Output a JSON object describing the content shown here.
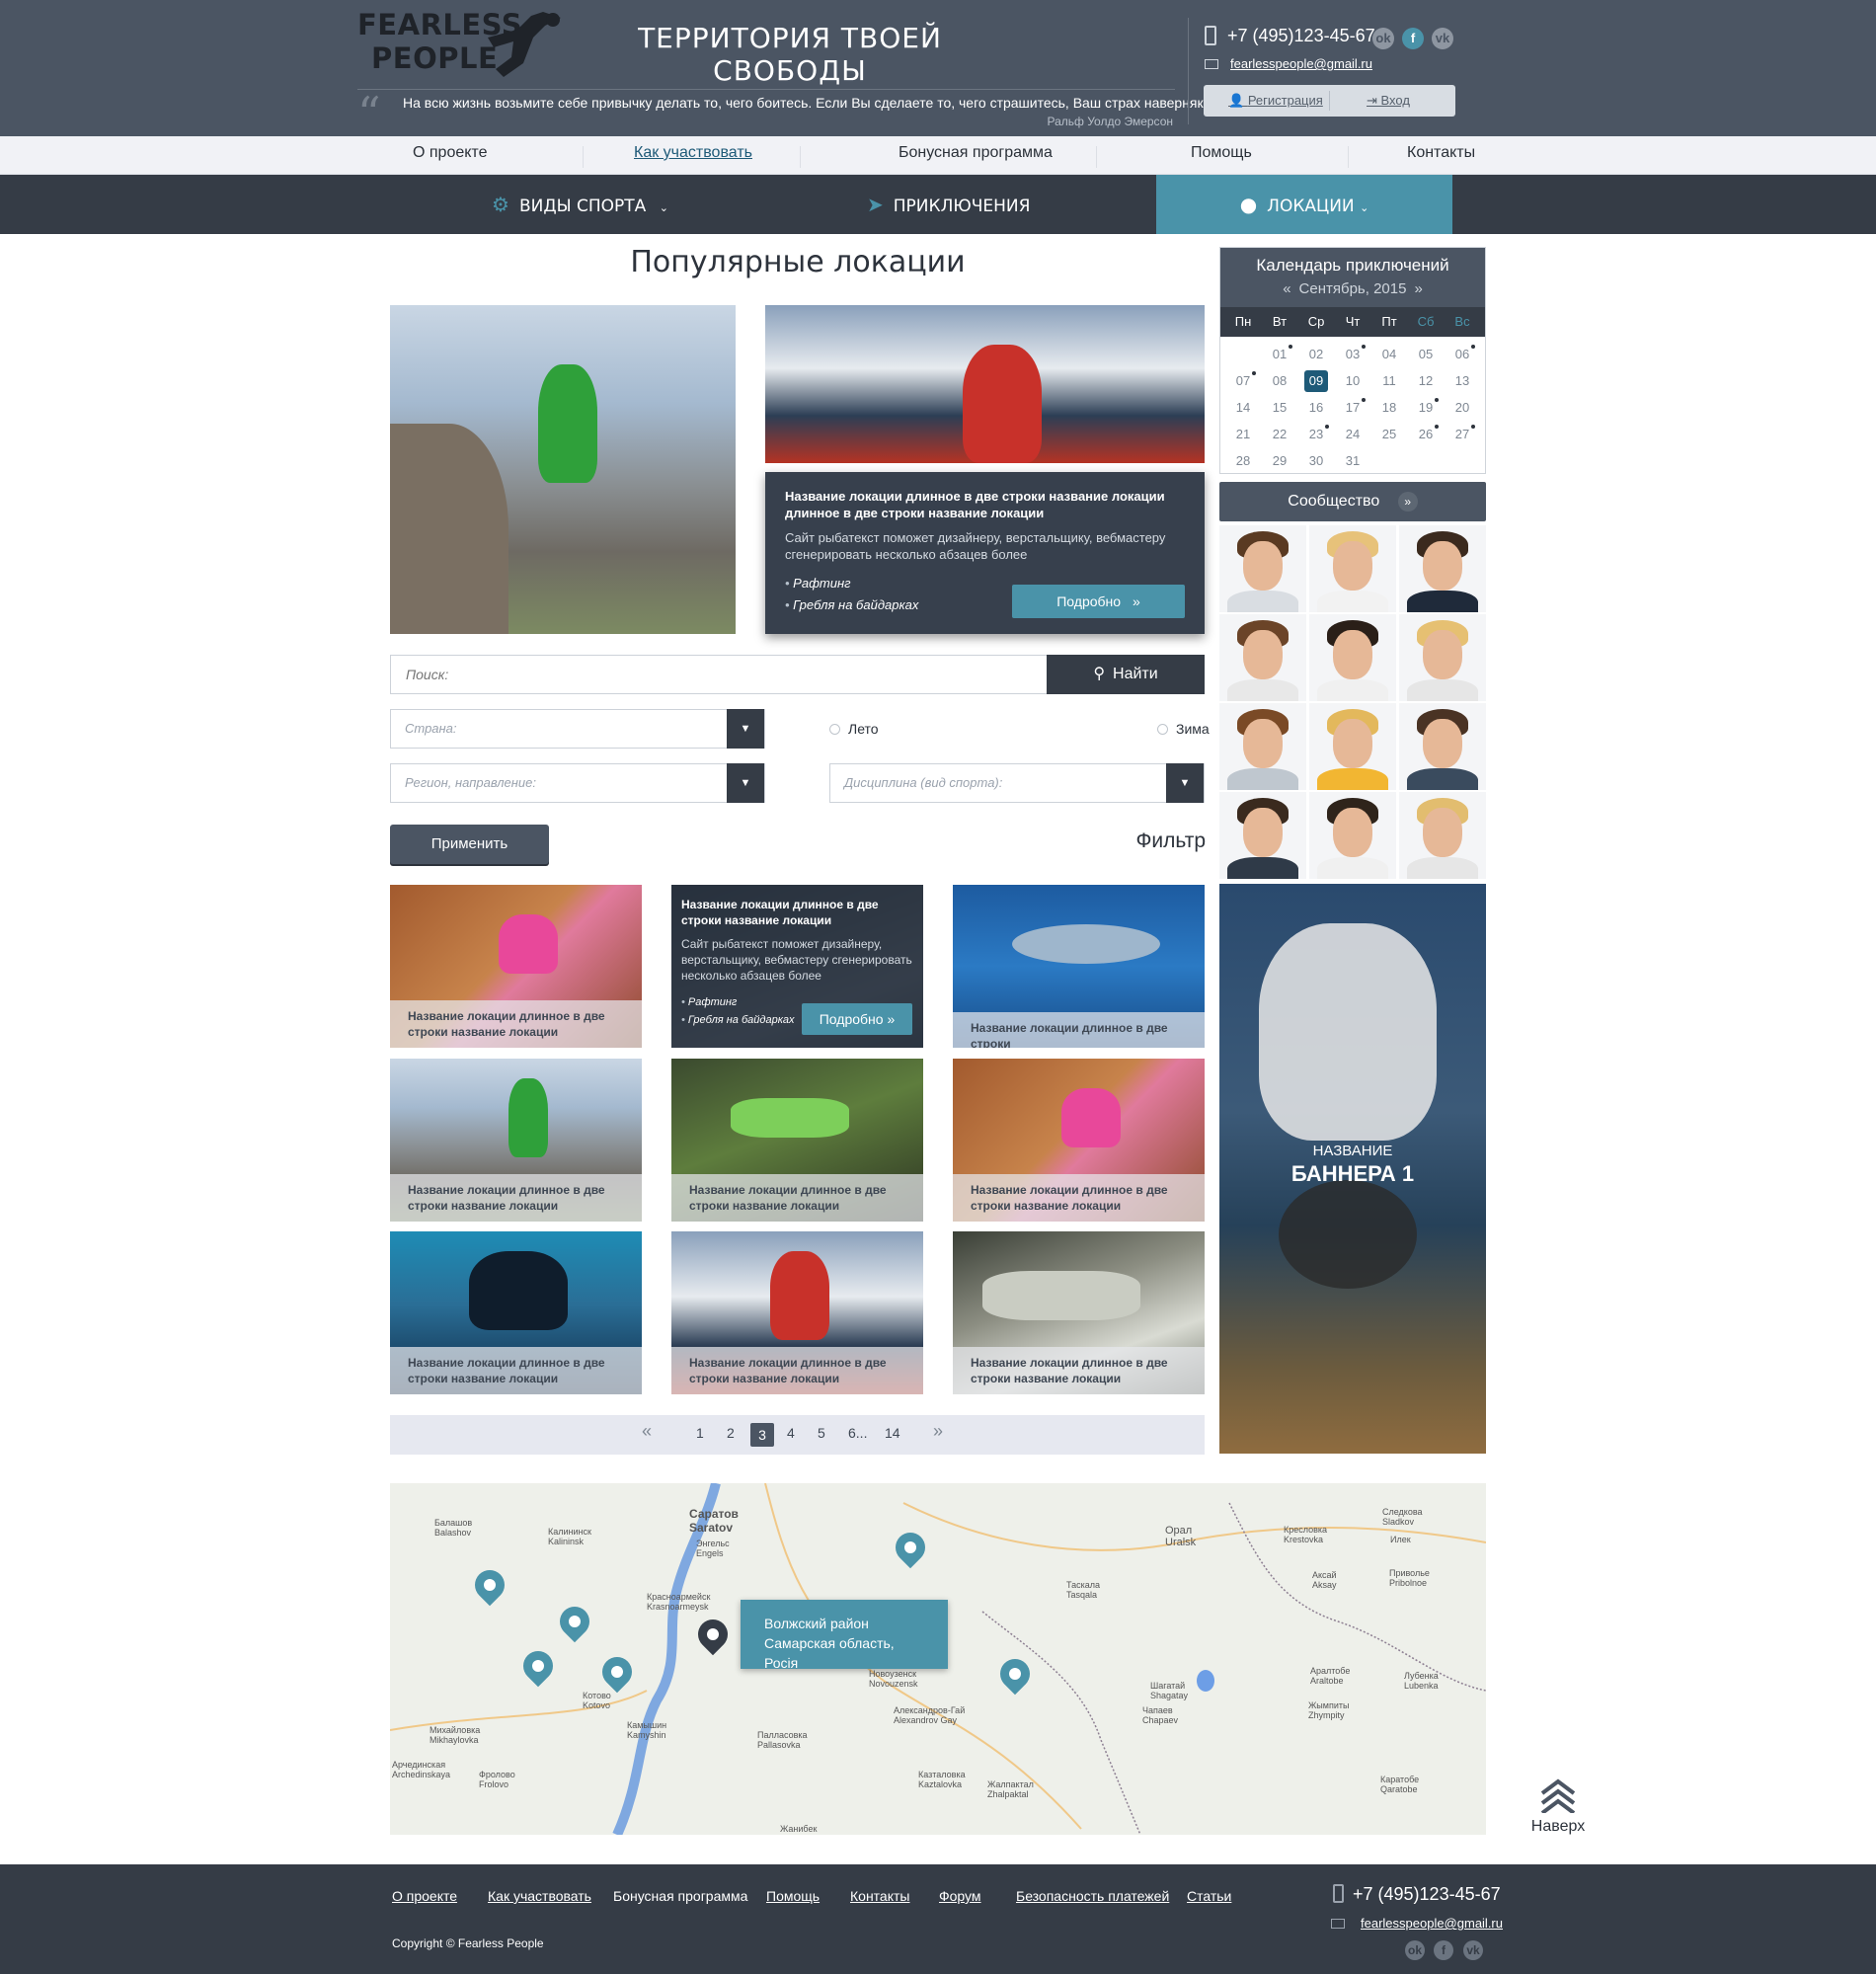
{
  "header": {
    "logo_line1": "FEARLESS",
    "logo_line2": "PEOPLE",
    "tagline": "ТЕРРИТОРИЯ ТВОЕЙ СВОБОДЫ",
    "quote": "На всю жизнь возьмите себе привычку делать то, чего боитесь. Если Вы сделаете то, чего страшитесь, Ваш страх наверняка умрёт.",
    "quote_author": "Ральф Уолдо Эмерсон",
    "phone": "+7 (495)123-45-67",
    "email": "fearlesspeople@gmail.ru",
    "social": [
      "odnoklassniki-icon",
      "facebook-icon",
      "vk-icon"
    ],
    "register": "Регистрация",
    "login": "Вход"
  },
  "nav1": [
    "О проекте",
    "Как участвовать",
    "Бонусная программа",
    "Помощь",
    "Контакты"
  ],
  "nav2": [
    {
      "label": "ВИДЫ СПОРТА",
      "icon": "bicycle-icon"
    },
    {
      "label": "ПРИКЛЮЧЕНИЯ",
      "icon": "paper-plane-icon"
    },
    {
      "label": "ЛОКАЦИИ",
      "icon": "map-marker-icon",
      "active": true
    }
  ],
  "main": {
    "title": "Популярные локации",
    "featured": {
      "title": "Название локации длинное в две строки название локации длинное в две строки название локации",
      "description": "Сайт рыбатекст поможет дизайнеру, верстальщику, вебмастеру сгенерировать несколько абзацев более",
      "tags": [
        "Рафтинг",
        "Гребля на байдарках"
      ],
      "button": "Подробно"
    },
    "search": {
      "placeholder": "Поиск:",
      "button": "Найти"
    },
    "filters": {
      "country": "Страна:",
      "region": "Регион, направление:",
      "discipline": "Дисциплина (вид спорта):",
      "season_summer": "Лето",
      "season_winter": "Зима",
      "apply": "Применить",
      "label": "Фильтр"
    },
    "grid_overlay": {
      "title": "Название локации длинное в две строки название локации",
      "description": "Сайт рыбатекст поможет дизайнеру, верстальщику, вебмастеру сгенерировать несколько абзацев более",
      "tags": [
        "Рафтинг",
        "Гребля на байдарках"
      ],
      "button": "Подробно"
    },
    "cards": [
      "Название локации длинное в две строки название локации",
      "Название локации длинное в две строки",
      "Название локации длинное в две строки название локации",
      "Название локации длинное в две строки название локации",
      "Название локации длинное в две строки название локации",
      "Название локации длинное в две строки название локации",
      "Название локации длинное в две строки название локации",
      "Название локации длинное в две строки название локации"
    ],
    "pagination": {
      "prev": "«",
      "pages": [
        "1",
        "2",
        "3",
        "4",
        "5",
        "6...",
        "14"
      ],
      "active": "3",
      "next": "»"
    }
  },
  "map": {
    "tooltip_line1": "Волжский район",
    "tooltip_line2": "Самарская область, Росія",
    "labels": [
      "Саратов",
      "Saratov",
      "Энгельс",
      "Engels",
      "Балашов",
      "Balashov",
      "Калининск",
      "Kalininsk",
      "Красноармейск",
      "Krasnoarmeysk",
      "Котово",
      "Kotovo",
      "Камышин",
      "Kamyshin",
      "Михайловка",
      "Mikhaylovka",
      "Фролово",
      "Frolovo",
      "Арчединская",
      "Archedinskaya",
      "Новоузенск",
      "Novouzensk",
      "Александров-Гай",
      "Alexandrov Gay",
      "Палласовка",
      "Pallasovka",
      "Орал",
      "Uralsk",
      "Таскала",
      "Tasqala",
      "Шагатай",
      "Shagatay",
      "Чапаев",
      "Chapaev",
      "Казталовка",
      "Kaztalovka",
      "Жалпактал",
      "Zhalpaktal",
      "Кресловка",
      "Krestovka",
      "Следкова",
      "Sladkov",
      "Аксай",
      "Aksay",
      "Илек",
      "Приволье",
      "Pribolnoe",
      "Жымпиты",
      "Zhympity",
      "Аралтобе",
      "Araltobe",
      "Лубенка",
      "Lubenka",
      "Каратобе",
      "Qaratobe",
      "Жанибек"
    ]
  },
  "sidebar": {
    "calendar": {
      "title": "Календарь приключений",
      "month": "Сентябрь, 2015",
      "prev": "«",
      "next": "»",
      "weekdays": [
        "Пн",
        "Вт",
        "Ср",
        "Чт",
        "Пт",
        "Сб",
        "Вс"
      ],
      "weeks": [
        [
          "",
          "01",
          "02",
          "03",
          "04",
          "05",
          "06"
        ],
        [
          "07",
          "08",
          "09",
          "10",
          "11",
          "12",
          "13"
        ],
        [
          "14",
          "15",
          "16",
          "17",
          "18",
          "19",
          "20"
        ],
        [
          "21",
          "22",
          "23",
          "24",
          "25",
          "26",
          "27"
        ],
        [
          "28",
          "29",
          "30",
          "31",
          "",
          "",
          ""
        ]
      ],
      "today": "09",
      "event_days": [
        "01",
        "03",
        "06",
        "07",
        "17",
        "19",
        "23",
        "26",
        "27"
      ]
    },
    "community": {
      "label": "Сообщество",
      "arrow": "»"
    },
    "banner": {
      "line1": "НАЗВАНИЕ",
      "line2": "БАННЕРА 1"
    }
  },
  "totop": "Наверх",
  "footer": {
    "links": [
      "О проекте",
      "Как участвовать",
      "Бонусная программа",
      "Помощь",
      "Контакты",
      "Форум",
      "Безопасность платежей",
      "Статьи"
    ],
    "phone": "+7 (495)123-45-67",
    "email": "fearlesspeople@gmail.ru",
    "copyright": "Copyright © Fearless People"
  },
  "colors": {
    "accent": "#4a93a9",
    "dark": "#353c46",
    "header": "#4b5563"
  }
}
